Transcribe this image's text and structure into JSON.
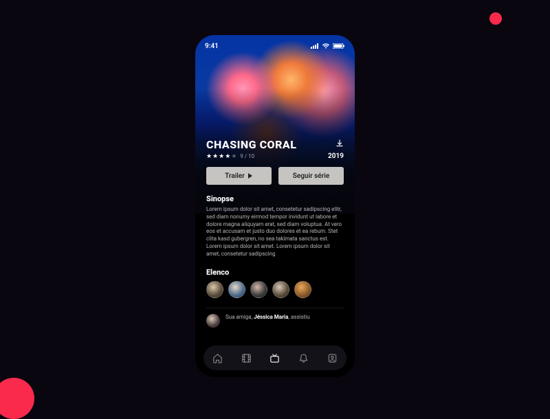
{
  "status": {
    "time": "9:41"
  },
  "movie": {
    "title": "CHASING CORAL",
    "rating_text": "9 / 10",
    "year": "2019",
    "stars_filled": 4,
    "stars_total": 5
  },
  "buttons": {
    "trailer": "Trailer",
    "follow": "Seguir série"
  },
  "sections": {
    "synopsis_heading": "Sinopse",
    "synopsis_body": "Lorem ipsum dolor sit amet, consetetur sadipscing elitr, sed diam nonumy eirmod tempor invidunt ut labore et dolore magna aliquyam erat, sed diam voluptua. At vero eos et accusam et justo duo dolores et ea rebum. Stet clita kasd gubergren, no sea takimata sanctus est. Lorem ipsum dolor sit amet. Lorem ipsum dolor sit amet, consetetur sadipscing",
    "cast_heading": "Elenco"
  },
  "feed": {
    "prefix": "Sua amiga, ",
    "name": "Jéssica Maria",
    "suffix": ", assistiu"
  },
  "nav": [
    "home",
    "movies",
    "tv",
    "alerts",
    "profile"
  ]
}
